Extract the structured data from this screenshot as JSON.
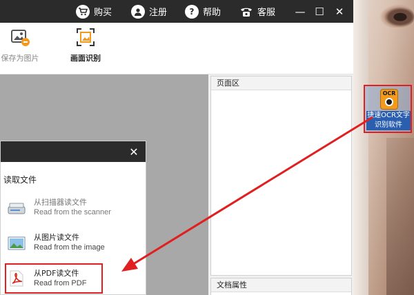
{
  "topbar": {
    "buy": "购买",
    "register": "注册",
    "help": "帮助",
    "service": "客服",
    "minimize": "—",
    "restore": "☐",
    "close": "✕"
  },
  "toolbar": {
    "save_as_image": "保存为图片",
    "screen_recognize": "画面识别"
  },
  "panels": {
    "page_area": "页面区",
    "doc_props": "文档属性"
  },
  "dialog": {
    "close": "✕",
    "title": "读取文件",
    "options": [
      {
        "zh": "从扫描器读文件",
        "en": "Read from the scanner"
      },
      {
        "zh": "从图片读文件",
        "en": "Read from the image"
      },
      {
        "zh": "从PDF读文件",
        "en": "Read from PDF"
      }
    ]
  },
  "desktop_icon": {
    "badge": "OCR",
    "label": "捷速OCR文字识别软件"
  },
  "colors": {
    "topbar": "#2b2b2b",
    "highlight": "#e02020",
    "workspace": "#a8a8a8"
  }
}
